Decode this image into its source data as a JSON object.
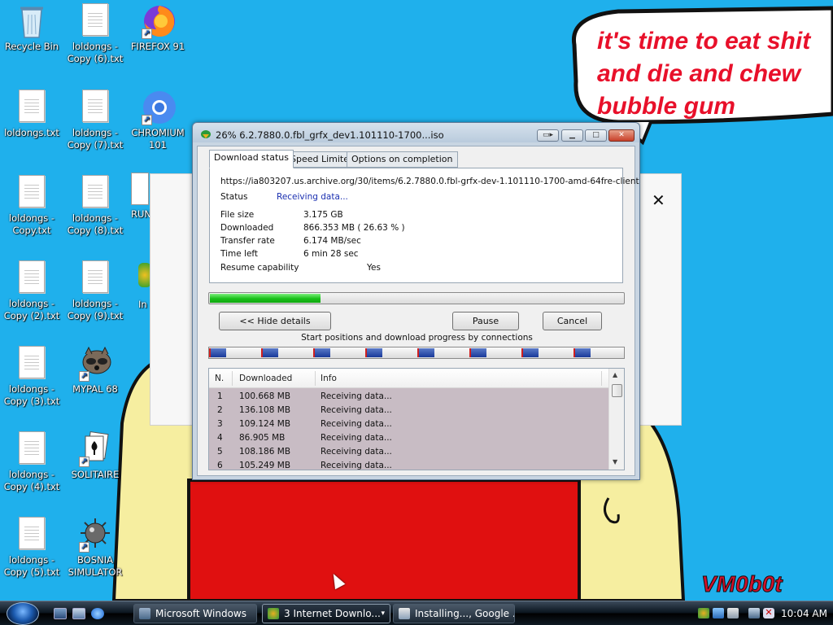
{
  "desktop": {
    "wallpaper_text": [
      "it's time to eat shit",
      "and die and chew",
      "bubble gum"
    ],
    "wallpaper_signature": "VM0b0t",
    "icons": [
      {
        "label": "Recycle Bin",
        "icon": "recycle-bin-icon"
      },
      {
        "label": "loldongs - Copy (6).txt",
        "icon": "text-file-icon"
      },
      {
        "label": "FIREFOX 91",
        "icon": "firefox-icon"
      },
      {
        "label": "loldongs.txt",
        "icon": "text-file-icon"
      },
      {
        "label": "loldongs - Copy (7).txt",
        "icon": "text-file-icon"
      },
      {
        "label": "CHROMIUM 101",
        "icon": "chromium-icon"
      },
      {
        "label": "loldongs - Copy.txt",
        "icon": "text-file-icon"
      },
      {
        "label": "loldongs - Copy (8).txt",
        "icon": "text-file-icon"
      },
      {
        "label": "RUN",
        "icon": "run-icon"
      },
      {
        "label": "loldongs - Copy (2).txt",
        "icon": "text-file-icon"
      },
      {
        "label": "loldongs - Copy (9).txt",
        "icon": "text-file-icon"
      },
      {
        "label": "In Do",
        "icon": "internet-download-icon"
      },
      {
        "label": "loldongs - Copy (3).txt",
        "icon": "text-file-icon"
      },
      {
        "label": "MYPAL 68",
        "icon": "mypal-icon"
      },
      {
        "label": "loldongs - Copy (4).txt",
        "icon": "text-file-icon"
      },
      {
        "label": "SOLITAIRE",
        "icon": "solitaire-icon"
      },
      {
        "label": "loldongs - Copy (5).txt",
        "icon": "text-file-icon"
      },
      {
        "label": "BOSNIA SIMULATOR",
        "icon": "mine-icon"
      }
    ]
  },
  "dialog": {
    "title": "26% 6.2.7880.0.fbl_grfx_dev1.101110-1700...iso",
    "tabs": [
      "Download status",
      "Speed Limiter",
      "Options on completion"
    ],
    "url": "https://ia803207.us.archive.org/30/items/6.2.7880.0.fbl-grfx-dev-1.101110-1700-amd-64fre-client",
    "status_label": "Status",
    "status_value": "Receiving data...",
    "info": [
      {
        "label": "File size",
        "value": "3.175  GB"
      },
      {
        "label": "Downloaded",
        "value": "866.353  MB  ( 26.63 % )"
      },
      {
        "label": "Transfer rate",
        "value": "6.174  MB/sec"
      },
      {
        "label": "Time left",
        "value": "6 min 28 sec"
      },
      {
        "label": "Resume capability",
        "value": "Yes"
      }
    ],
    "progress_fraction": 0.2663,
    "buttons": {
      "hide_details": "<< Hide details",
      "pause": "Pause",
      "cancel": "Cancel"
    },
    "connections_label": "Start positions and download progress by connections",
    "connection_count": 8,
    "grid_headers": [
      "N.",
      "Downloaded",
      "Info"
    ],
    "grid_rows": [
      {
        "n": "1",
        "downloaded": "100.668  MB",
        "info": "Receiving data..."
      },
      {
        "n": "2",
        "downloaded": "136.108  MB",
        "info": "Receiving data..."
      },
      {
        "n": "3",
        "downloaded": "109.124  MB",
        "info": "Receiving data..."
      },
      {
        "n": "4",
        "downloaded": "86.905  MB",
        "info": "Receiving data..."
      },
      {
        "n": "5",
        "downloaded": "108.186  MB",
        "info": "Receiving data..."
      },
      {
        "n": "6",
        "downloaded": "105.249  MB",
        "info": "Receiving data..."
      }
    ]
  },
  "taskbar": {
    "buttons": [
      {
        "label": "Microsoft Windows"
      },
      {
        "label": "3 Internet Downlo...",
        "arrow": "▾"
      },
      {
        "label": "Installing..., Google ..."
      }
    ],
    "clock": "10:04 AM"
  },
  "colors": {
    "desktop_bg": "#1fb0ec",
    "progress_fill": "#18c018",
    "status_text": "#1a2fb0"
  }
}
